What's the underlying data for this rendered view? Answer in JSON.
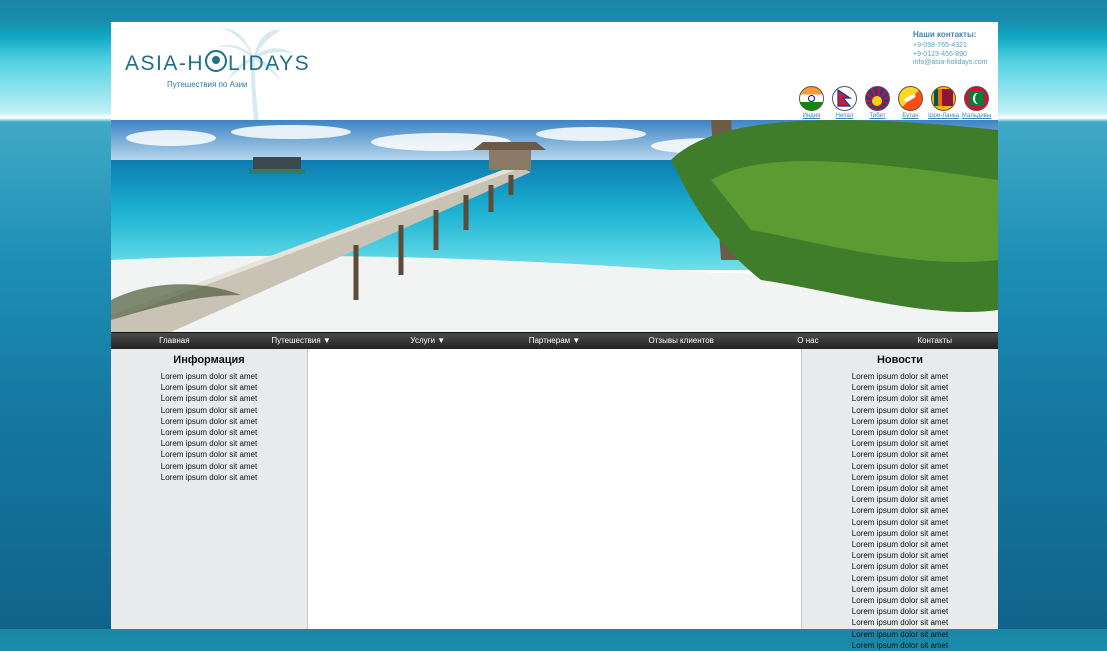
{
  "header": {
    "logo_text_left": "ASIA-H",
    "logo_text_right": "LIDAYS",
    "tagline": "Путешествия по Азии",
    "contacts": {
      "title": "Наши контакты:",
      "phone1": "+9-098-765-4321",
      "phone2": "+9-0123-456-890",
      "email": "info@asia-holidays.com"
    },
    "flags": [
      {
        "label": "Индия",
        "icon": "india-flag-icon"
      },
      {
        "label": "Непал",
        "icon": "nepal-flag-icon"
      },
      {
        "label": "Тибет",
        "icon": "tibet-flag-icon"
      },
      {
        "label": "Бутан",
        "icon": "bhutan-flag-icon"
      },
      {
        "label": "Шри-Ланка",
        "icon": "sri-lanka-flag-icon"
      },
      {
        "label": "Мальдивы",
        "icon": "maldives-flag-icon"
      }
    ]
  },
  "nav": {
    "items": [
      "Главная",
      "Путешествия ▼",
      "Услуги ▼",
      "Партнерам ▼",
      "Отзывы клиентов",
      "О нас",
      "Контакты"
    ]
  },
  "sidebar_left": {
    "title": "Информация",
    "items": [
      "Lorem ipsum dolor sit amet",
      "Lorem ipsum dolor sit amet",
      "Lorem ipsum dolor sit amet",
      "Lorem ipsum dolor sit amet",
      "Lorem ipsum dolor sit amet",
      "Lorem ipsum dolor sit amet",
      "Lorem ipsum dolor sit amet",
      "Lorem ipsum dolor sit amet",
      "Lorem ipsum dolor sit amet",
      "Lorem ipsum dolor sit amet"
    ]
  },
  "sidebar_right": {
    "title": "Новости",
    "items": [
      "Lorem ipsum dolor sit amet",
      "Lorem ipsum dolor sit amet",
      "Lorem ipsum dolor sit amet",
      "Lorem ipsum dolor sit amet",
      "Lorem ipsum dolor sit amet",
      "Lorem ipsum dolor sit amet",
      "Lorem ipsum dolor sit amet",
      "Lorem ipsum dolor sit amet",
      "Lorem ipsum dolor sit amet",
      "Lorem ipsum dolor sit amet",
      "Lorem ipsum dolor sit amet",
      "Lorem ipsum dolor sit amet",
      "Lorem ipsum dolor sit amet",
      "Lorem ipsum dolor sit amet",
      "Lorem ipsum dolor sit amet",
      "Lorem ipsum dolor sit amet",
      "Lorem ipsum dolor sit amet",
      "Lorem ipsum dolor sit amet",
      "Lorem ipsum dolor sit amet",
      "Lorem ipsum dolor sit amet",
      "Lorem ipsum dolor sit amet",
      "Lorem ipsum dolor sit amet",
      "Lorem ipsum dolor sit amet",
      "Lorem ipsum dolor sit amet",
      "Lorem ipsum dolor sit amet"
    ]
  },
  "colors": {
    "brand_teal": "#1f6f86",
    "nav_bg": "#2b2b2b",
    "sidebar_bg": "#e9eaeb"
  }
}
